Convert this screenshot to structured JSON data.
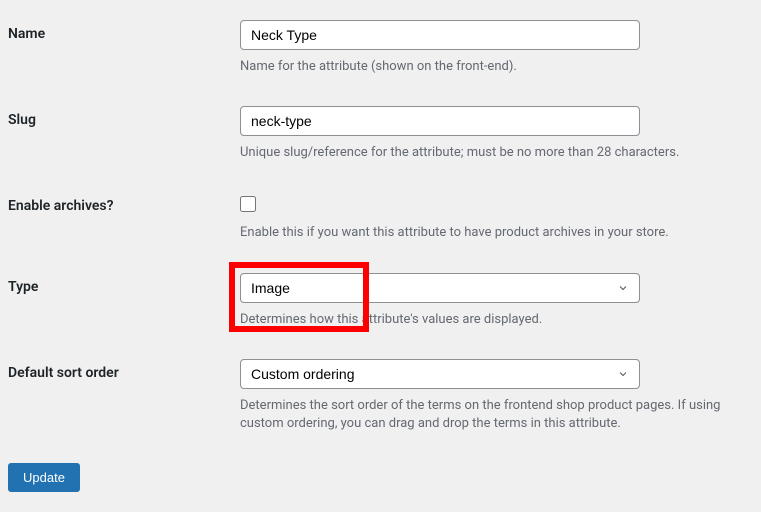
{
  "fields": {
    "name": {
      "label": "Name",
      "value": "Neck Type",
      "description": "Name for the attribute (shown on the front-end)."
    },
    "slug": {
      "label": "Slug",
      "value": "neck-type",
      "description": "Unique slug/reference for the attribute; must be no more than 28 characters."
    },
    "archives": {
      "label": "Enable archives?",
      "description": "Enable this if you want this attribute to have product archives in your store."
    },
    "type": {
      "label": "Type",
      "selected": "Image",
      "description": "Determines how this attribute's values are displayed."
    },
    "sort": {
      "label": "Default sort order",
      "selected": "Custom ordering",
      "description": "Determines the sort order of the terms on the frontend shop product pages. If using custom ordering, you can drag and drop the terms in this attribute."
    }
  },
  "buttons": {
    "update": "Update"
  }
}
